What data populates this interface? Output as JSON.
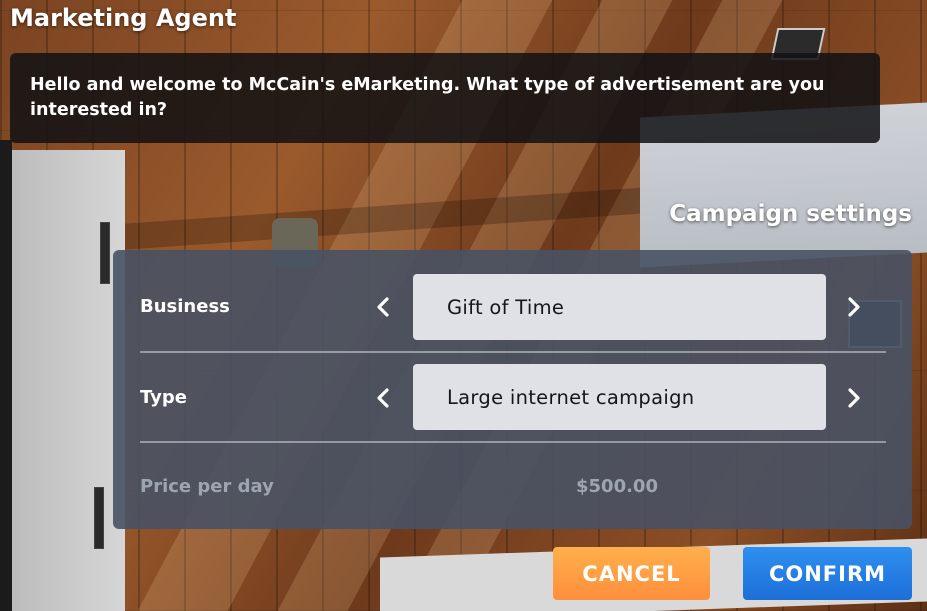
{
  "window": {
    "title": "Marketing Agent"
  },
  "dialog": {
    "message": "Hello and welcome to McCain's eMarketing. What type of advertisement are you interested in?"
  },
  "campaign": {
    "section_title": "Campaign settings",
    "business": {
      "label": "Business",
      "value": "Gift of Time"
    },
    "type": {
      "label": "Type",
      "value": "Large internet campaign"
    },
    "price": {
      "label": "Price per day",
      "value": "$500.00"
    }
  },
  "actions": {
    "cancel_label": "CANCEL",
    "confirm_label": "CONFIRM"
  },
  "icons": {
    "prev": "chevron-left-icon",
    "next": "chevron-right-icon"
  },
  "colors": {
    "cancel": "#ff9a40",
    "confirm": "#2680e6",
    "panel": "#485264",
    "selector": "#dfe1e7"
  }
}
